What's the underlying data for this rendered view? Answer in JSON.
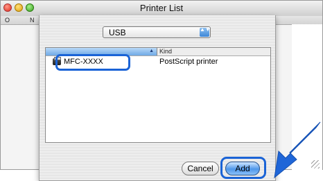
{
  "window": {
    "title": "Printer List"
  },
  "toolbar": {
    "first_col_label": "O",
    "second_col_label": "N"
  },
  "sheet": {
    "connection_popup": {
      "selected": "USB",
      "arrows": "▲▼"
    },
    "list": {
      "columns": {
        "name_sort": "▲",
        "kind": "Kind"
      },
      "rows": [
        {
          "name": "MFC-XXXX",
          "kind": "PostScript printer"
        }
      ]
    },
    "buttons": {
      "cancel": "Cancel",
      "add": "Add"
    }
  },
  "colors": {
    "highlight": "#1a63d6",
    "arrow": "#1f66d8",
    "default_button": "#4f97ea"
  }
}
